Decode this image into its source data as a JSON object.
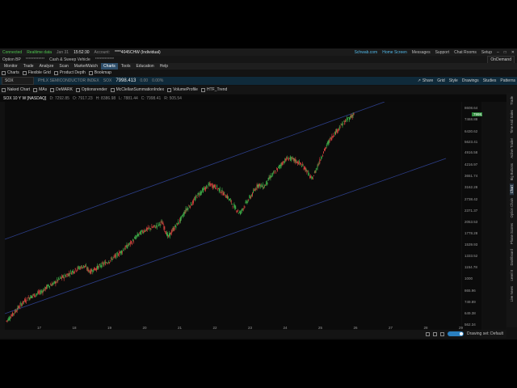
{
  "status_bar": {
    "connected": "Connected",
    "realtime": "Realtime data",
    "date": "Jan 31",
    "time": "15:52:30",
    "account_label": "Account:",
    "account_value": "****4045CHW (Individual)",
    "links": [
      "Schwab.com",
      "Home Screen",
      "Messages",
      "Support",
      "Chat Rooms",
      "Setup"
    ]
  },
  "account_bar": {
    "option_bp": "Option BP",
    "masked": "************",
    "cash": "Cash & Sweep Vehicle",
    "masked2": "************",
    "ondemand": "OnDemand"
  },
  "main_tabs": [
    "Monitor",
    "Trade",
    "Analyze",
    "Scan",
    "MarketWatch",
    "Charts",
    "Tools",
    "Education",
    "Help"
  ],
  "active_main_tab": "Charts",
  "sub_tabs": [
    "Charts",
    "Flexible Grid",
    "Product Depth",
    "Bookmap"
  ],
  "symbol_bar": {
    "symbol": "SOX",
    "description": "PHLX SEMICONDUCTOR INDEX",
    "code": "SOX",
    "price": "7998.413",
    "change": "0.00",
    "change_pct": "0.00%",
    "actions": [
      "Share",
      "Grid",
      "Style",
      "Drawings",
      "Studies",
      "Patterns"
    ]
  },
  "study_bar": {
    "items": [
      "Naked Chart",
      "MAs",
      "DeMARK",
      "Optionsrender",
      "McClellanSummationIndex",
      "VolumeProfile",
      "HTF_Trend"
    ]
  },
  "chart_header": {
    "title": "SOX 10 Y W [NASDAQ]",
    "ohlc": [
      "D: 7292.85",
      "O: 7917.23",
      "H: 8386.98",
      "L: 7881.44",
      "C: 7998.41",
      "R: 505.54"
    ]
  },
  "y_axis": [
    "8608.64",
    "7468.88",
    "6430.62",
    "5623.41",
    "4916.58",
    "4216.97",
    "3651.74",
    "3162.28",
    "2738.42",
    "2371.37",
    "2053.53",
    "1778.28",
    "1539.93",
    "1333.52",
    "1154.78",
    "1000",
    "865.96",
    "749.89",
    "649.38",
    "562.34"
  ],
  "last_price": "7998.41",
  "x_axis": [
    "17",
    "18",
    "19",
    "20",
    "21",
    "22",
    "23",
    "24",
    "25",
    "26",
    "27",
    "28",
    "29"
  ],
  "side_tabs": [
    "Trade",
    "Time And Sales",
    "Active Trader",
    "Big Buttons",
    "Chart",
    "Option Chain",
    "Phase Scores",
    "Dashboard",
    "Level II",
    "Live News"
  ],
  "active_side_tab": "Chart",
  "bottom_bar": {
    "drawing_set": "Drawing set: Default"
  },
  "colors": {
    "up": "#3fb24a",
    "down": "#d9433f",
    "channel": "#2d3f8a",
    "accent": "#52b8e8"
  },
  "chart_data": {
    "type": "candlestick",
    "title": "SOX 10 Y W [NASDAQ]",
    "y_scale": "log",
    "ylim": [
      562.34,
      8608.64
    ],
    "x_labels": [
      "17",
      "18",
      "19",
      "20",
      "21",
      "22",
      "23",
      "24",
      "25",
      "26",
      "27",
      "28",
      "29"
    ],
    "series": [
      {
        "values": [
          590,
          640,
          700,
          760,
          800,
          830,
          860,
          920,
          950,
          1010,
          1050,
          1100,
          1150,
          1180,
          1100,
          1150,
          1200,
          1250,
          1320,
          1400,
          1500,
          1600,
          1750,
          1850,
          1900,
          1950,
          2050,
          1700,
          1900,
          2100,
          2400,
          2600,
          2900,
          3100,
          3300,
          3200,
          3000,
          2800,
          2500,
          2300,
          2600,
          2900,
          3300,
          3200,
          3600,
          3900,
          4300,
          4600,
          4500,
          4300,
          4000,
          3500,
          4200,
          5000,
          5800,
          6400,
          7000,
          7500,
          7998
        ]
      }
    ],
    "channel_lines": 2
  }
}
